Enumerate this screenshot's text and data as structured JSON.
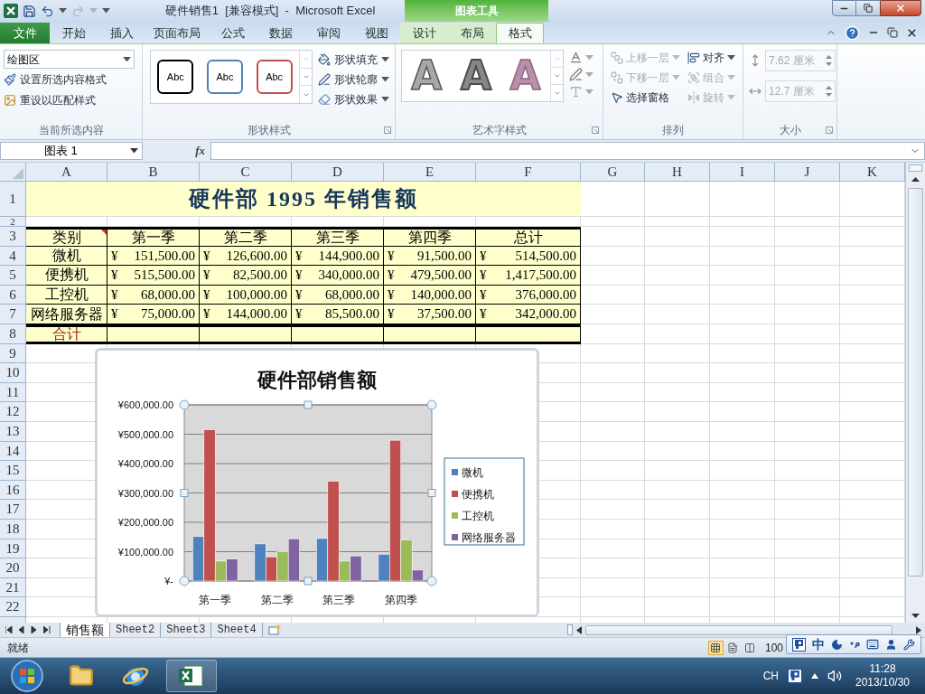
{
  "title_bar": {
    "title": "硬件销售1  [兼容模式]  -  Microsoft Excel",
    "context_group": "图表工具"
  },
  "ribbon_tabs": [
    {
      "label": "文件",
      "kind": "file",
      "selected": false
    },
    {
      "label": "开始",
      "kind": "normal",
      "selected": false
    },
    {
      "label": "插入",
      "kind": "normal",
      "selected": false
    },
    {
      "label": "页面布局",
      "kind": "normal",
      "selected": false
    },
    {
      "label": "公式",
      "kind": "normal",
      "selected": false
    },
    {
      "label": "数据",
      "kind": "normal",
      "selected": false
    },
    {
      "label": "审阅",
      "kind": "normal",
      "selected": false
    },
    {
      "label": "视图",
      "kind": "normal",
      "selected": false
    },
    {
      "label": "设计",
      "kind": "context",
      "selected": false
    },
    {
      "label": "布局",
      "kind": "context",
      "selected": false
    },
    {
      "label": "格式",
      "kind": "context",
      "selected": true
    }
  ],
  "current_selection": {
    "dropdown": "绘图区",
    "buttons": [
      "设置所选内容格式",
      "重设以匹配样式"
    ],
    "label": "当前所选内容"
  },
  "shape_styles": {
    "swatches": [
      {
        "text": "Abc",
        "color": "#000000"
      },
      {
        "text": "Abc",
        "color": "#4f81bd"
      },
      {
        "text": "Abc",
        "color": "#c0504d"
      }
    ],
    "buttons": [
      "形状填充",
      "形状轮廓",
      "形状效果"
    ],
    "label": "形状样式"
  },
  "wordart_styles": {
    "samples": [
      {
        "text": "A",
        "kind": "outline"
      },
      {
        "text": "A",
        "kind": "shadow"
      },
      {
        "text": "A",
        "kind": "faint"
      }
    ],
    "label": "艺术字样式"
  },
  "arrange": {
    "buttons": [
      {
        "label": "上移一层",
        "disabled": true
      },
      {
        "label": "下移一层",
        "disabled": true
      },
      {
        "label": "选择窗格",
        "disabled": false
      },
      {
        "label": "对齐",
        "disabled": false
      },
      {
        "label": "组合",
        "disabled": true
      },
      {
        "label": "旋转",
        "disabled": true
      }
    ],
    "label": "排列"
  },
  "size": {
    "fields": [
      {
        "value": "7.62 厘米",
        "disabled": true
      },
      {
        "value": "12.7 厘米",
        "disabled": true
      }
    ],
    "label": "大小"
  },
  "formula_bar": {
    "name_box": "图表 1",
    "function_label": "fx"
  },
  "columns": [
    "A",
    "B",
    "C",
    "D",
    "E",
    "F",
    "G",
    "H",
    "I",
    "J",
    "K"
  ],
  "row_numbers": [
    "1",
    "2",
    "3",
    "4",
    "5",
    "6",
    "7",
    "8",
    "9",
    "10",
    "11",
    "12",
    "13",
    "14",
    "15",
    "16",
    "17",
    "18",
    "19",
    "20",
    "21",
    "22"
  ],
  "sheet": {
    "title": "硬件部 1995 年销售额",
    "headers": [
      {
        "text": "类别",
        "comment": true
      },
      {
        "text": "第一季",
        "comment": false
      },
      {
        "text": "第二季",
        "comment": false
      },
      {
        "text": "第三季",
        "comment": false
      },
      {
        "text": "第四季",
        "comment": false
      },
      {
        "text": "总计",
        "comment": false
      }
    ],
    "rows": [
      {
        "label": "微机",
        "values": [
          {
            "symbol": "¥",
            "amount": "151,500.00"
          },
          {
            "symbol": "¥",
            "amount": "126,600.00"
          },
          {
            "symbol": "¥",
            "amount": "144,900.00"
          },
          {
            "symbol": "¥",
            "amount": "91,500.00"
          },
          {
            "symbol": "¥",
            "amount": "514,500.00"
          }
        ]
      },
      {
        "label": "便携机",
        "values": [
          {
            "symbol": "¥",
            "amount": "515,500.00"
          },
          {
            "symbol": "¥",
            "amount": "82,500.00"
          },
          {
            "symbol": "¥",
            "amount": "340,000.00"
          },
          {
            "symbol": "¥",
            "amount": "479,500.00"
          },
          {
            "symbol": "¥",
            "amount": "1,417,500.00"
          }
        ]
      },
      {
        "label": "工控机",
        "values": [
          {
            "symbol": "¥",
            "amount": "68,000.00"
          },
          {
            "symbol": "¥",
            "amount": "100,000.00"
          },
          {
            "symbol": "¥",
            "amount": "68,000.00"
          },
          {
            "symbol": "¥",
            "amount": "140,000.00"
          },
          {
            "symbol": "¥",
            "amount": "376,000.00"
          }
        ]
      },
      {
        "label": "网络服务器",
        "values": [
          {
            "symbol": "¥",
            "amount": "75,000.00"
          },
          {
            "symbol": "¥",
            "amount": "144,000.00"
          },
          {
            "symbol": "¥",
            "amount": "85,500.00"
          },
          {
            "symbol": "¥",
            "amount": "37,500.00"
          },
          {
            "symbol": "¥",
            "amount": "342,000.00"
          }
        ]
      }
    ],
    "total_label": "合计"
  },
  "chart": {
    "chart_data": {
      "type": "bar",
      "title": "硬件部销售额",
      "categories": [
        "第一季",
        "第二季",
        "第三季",
        "第四季"
      ],
      "series": [
        {
          "name": "微机",
          "color": "#4f81bd",
          "values": [
            151500,
            126600,
            144900,
            91500
          ]
        },
        {
          "name": "便携机",
          "color": "#c0504d",
          "values": [
            515500,
            82500,
            340000,
            479500
          ]
        },
        {
          "name": "工控机",
          "color": "#9bbb59",
          "values": [
            68000,
            100000,
            68000,
            140000
          ]
        },
        {
          "name": "网络服务器",
          "color": "#8064a2",
          "values": [
            75000,
            144000,
            85500,
            37500
          ]
        }
      ],
      "grid": true,
      "legend": true,
      "ylim": [
        0,
        600000
      ],
      "yticks": [
        {
          "value": 0,
          "label": "¥-"
        },
        {
          "value": 100000,
          "label": "¥100,000.00"
        },
        {
          "value": 200000,
          "label": "¥200,000.00"
        },
        {
          "value": 300000,
          "label": "¥300,000.00"
        },
        {
          "value": 400000,
          "label": "¥400,000.00"
        },
        {
          "value": 500000,
          "label": "¥500,000.00"
        },
        {
          "value": 600000,
          "label": "¥600,000.00"
        }
      ]
    }
  },
  "sheet_tabs": [
    {
      "label": "销售额",
      "selected": true
    },
    {
      "label": "Sheet2",
      "selected": false
    },
    {
      "label": "Sheet3",
      "selected": false
    },
    {
      "label": "Sheet4",
      "selected": false
    }
  ],
  "status_bar": {
    "status": "就绪",
    "zoom": "100"
  },
  "ime_bar": {
    "mode": "中"
  },
  "taskbar": {
    "language": "CH",
    "time": "11:28",
    "date": "2013/10/30"
  }
}
